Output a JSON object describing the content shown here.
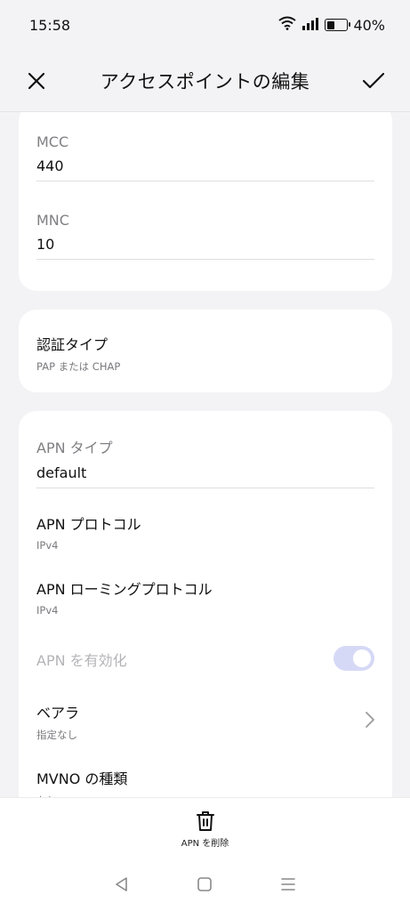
{
  "status_bar": {
    "time": "15:58",
    "battery": "40%",
    "battery_level": 0.4
  },
  "header": {
    "title": "アクセスポイントの編集"
  },
  "fields": [
    {
      "label": "MCC",
      "value": "440"
    },
    {
      "label": "MNC",
      "value": "10"
    }
  ],
  "auth": {
    "title": "認証タイプ",
    "value": "PAP または CHAP"
  },
  "apn_type": {
    "label": "APN タイプ",
    "value": "default"
  },
  "rows": {
    "protocol": {
      "title": "APN プロトコル",
      "value": "IPv4"
    },
    "roaming": {
      "title": "APN ローミングプロトコル",
      "value": "IPv4"
    },
    "enable": {
      "title": "APN を有効化",
      "enabled": true
    },
    "bearer": {
      "title": "ベアラ",
      "value": "指定なし"
    },
    "mvno": {
      "title": "MVNO の種類",
      "value": "なし"
    }
  },
  "bottom": {
    "delete_label": "APN を削除"
  },
  "colors": {
    "accent": "#d6d9f6",
    "background": "#f3f3f5"
  }
}
